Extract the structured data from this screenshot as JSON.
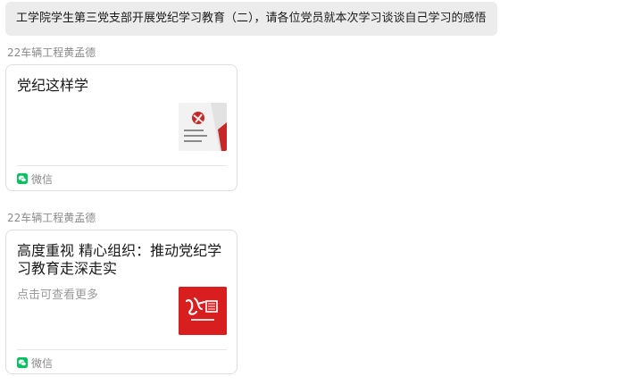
{
  "message": {
    "text": "工学院学生第三党支部开展党纪学习教育（二），请各位党员就本次学习谈谈自己学习的感悟"
  },
  "posts": [
    {
      "sender": "22车辆工程黄孟德",
      "card": {
        "title": "党纪这样学",
        "description": "",
        "thumbnail_icon": "party-regulations-book-cover",
        "source": "微信"
      }
    },
    {
      "sender": "22车辆工程黄孟德",
      "card": {
        "title": "高度重视 精心组织：推动党纪学习教育走深走实",
        "description": "点击可查看更多",
        "thumbnail_icon": "xuexi-calligraphy-logo",
        "source": "微信"
      }
    }
  ],
  "colors": {
    "bubble_bg": "#ececec",
    "wechat_green": "#07c160",
    "thumb_red": "#d81e1e"
  }
}
